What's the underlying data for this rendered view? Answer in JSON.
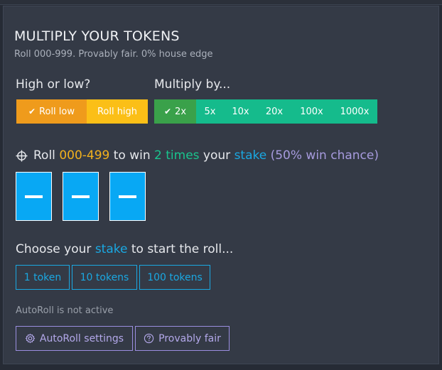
{
  "header": {
    "title": "MULTIPLY YOUR TOKENS",
    "subtitle": "Roll 000-999. Provably fair. 0% house edge"
  },
  "high_low": {
    "label": "High or low?",
    "options": [
      {
        "label": "Roll low",
        "selected": true
      },
      {
        "label": "Roll high",
        "selected": false
      }
    ]
  },
  "multiply": {
    "label": "Multiply by...",
    "options": [
      {
        "label": "2x",
        "selected": true
      },
      {
        "label": "5x",
        "selected": false
      },
      {
        "label": "10x",
        "selected": false
      },
      {
        "label": "20x",
        "selected": false
      },
      {
        "label": "100x",
        "selected": false
      },
      {
        "label": "1000x",
        "selected": false
      }
    ]
  },
  "roll_info": {
    "icon": "crosshair-icon",
    "w1": "Roll",
    "range": "000-499",
    "w2": "to win",
    "times": "2 times",
    "w3": "your",
    "stake_word": "stake",
    "chance": "(50% win chance)"
  },
  "digits": [
    "—",
    "—",
    "—"
  ],
  "stake": {
    "prefix": "Choose your",
    "highlight": "stake",
    "suffix": "to start the roll...",
    "options": [
      "1 token",
      "10 tokens",
      "100 tokens"
    ]
  },
  "autoroll": {
    "status": "AutoRoll is not active",
    "settings_label": "AutoRoll settings",
    "fair_label": "Provably fair"
  },
  "colors": {
    "panel": "#343a46",
    "roll_low": "#ef9b1c",
    "roll_high": "#fbbf17",
    "multiplier": "#15bb8c",
    "multiplier_active": "#3aa14a",
    "digit_box": "#08a8f4",
    "stake_blue": "#1aa8e2",
    "purple": "#a79bde"
  }
}
